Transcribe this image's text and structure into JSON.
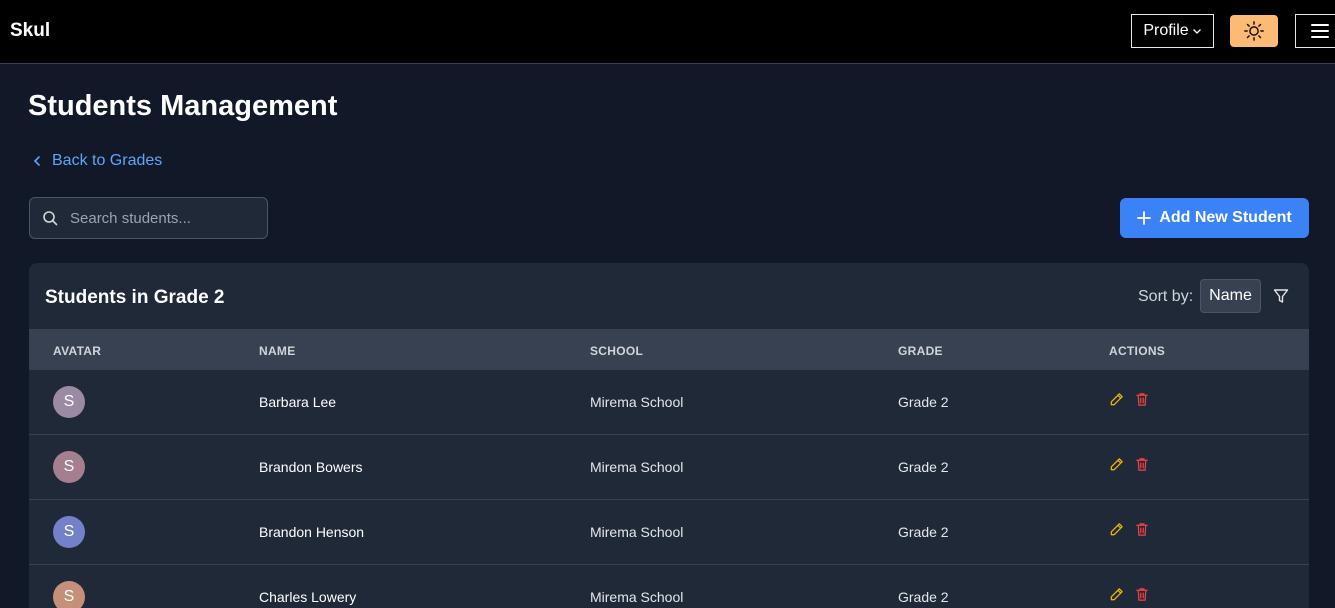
{
  "navbar": {
    "brand": "Skul",
    "profile_label": "Profile",
    "theme_color": "#fdba74"
  },
  "page": {
    "title": "Students Management",
    "back_label": "Back to Grades"
  },
  "search": {
    "placeholder": "Search students..."
  },
  "add_button_label": "Add New Student",
  "card": {
    "title": "Students in Grade 2",
    "sort_label": "Sort by:",
    "sort_value": "Name"
  },
  "table": {
    "headers": [
      "AVATAR",
      "NAME",
      "SCHOOL",
      "GRADE",
      "ACTIONS"
    ],
    "rows": [
      {
        "initial": "S",
        "avatar_color": "#9a8aa3",
        "name": "Barbara Lee",
        "school": "Mirema School",
        "grade": "Grade 2"
      },
      {
        "initial": "S",
        "avatar_color": "#a47f8f",
        "name": "Brandon Bowers",
        "school": "Mirema School",
        "grade": "Grade 2"
      },
      {
        "initial": "S",
        "avatar_color": "#7480c8",
        "name": "Brandon Henson",
        "school": "Mirema School",
        "grade": "Grade 2"
      },
      {
        "initial": "S",
        "avatar_color": "#c4907a",
        "name": "Charles Lowery",
        "school": "Mirema School",
        "grade": "Grade 2"
      }
    ]
  },
  "colors": {
    "accent": "#3b82f6",
    "link": "#60a5fa",
    "edit_icon": "#eab308",
    "delete_icon": "#ef4444"
  },
  "icons": [
    "chevron-down-icon",
    "sun-icon",
    "menu-icon",
    "chevron-left-icon",
    "search-icon",
    "plus-icon",
    "filter-icon",
    "pencil-icon",
    "trash-icon"
  ]
}
